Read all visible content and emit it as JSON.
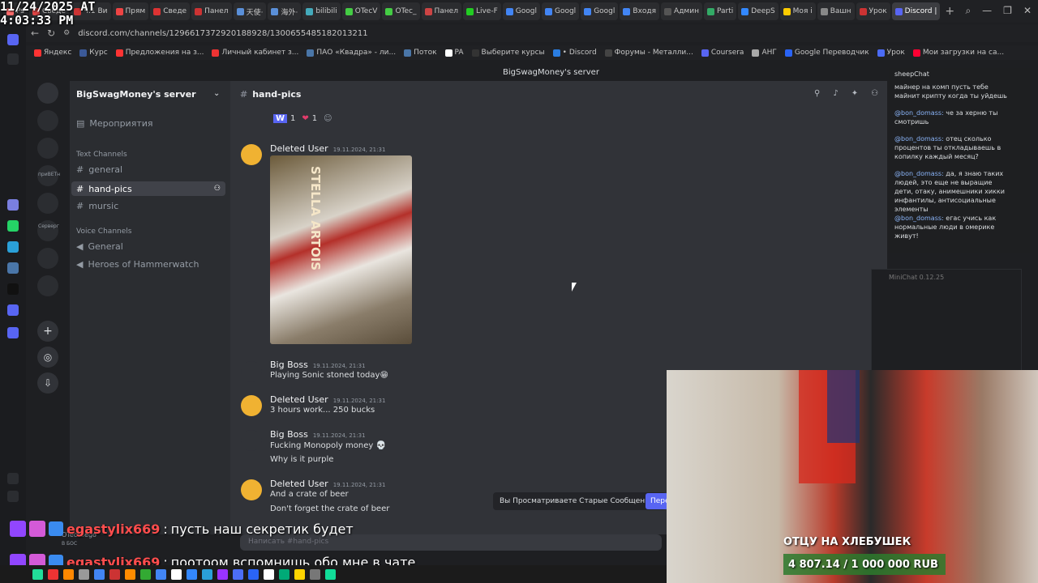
{
  "overlay": {
    "timestamp": "11/24/2025 AT\n4:03:33 PM"
  },
  "browser": {
    "tabs": [
      "Ps",
      "Сведе",
      "Ч.1 Ви",
      "Прям",
      "Сведе",
      "Панел",
      "天使·",
      "海外·",
      "bilibili",
      "OTecV",
      "OTec_",
      "Панел",
      "Live-F",
      "Googl",
      "Googl",
      "Googl",
      "Входя",
      "Админ",
      "Parti",
      "DeepS",
      "Моя і",
      "Вашн",
      "Урок",
      "Discord |"
    ],
    "url": "discord.com/channels/1296617372920188928/1300655485182013211",
    "bookmarks": [
      "Яндекс",
      "Курс",
      "Предложения на з...",
      "Личный кабинет з...",
      "ПАО «Квадра» - ли...",
      "Поток",
      "PA",
      "Выберите курсы",
      "• Discord",
      "Форумы - Металли...",
      "Coursera",
      "АНГ",
      "Google Переводчик",
      "Урок",
      "Мои загрузки на са..."
    ],
    "page_title": "BigSwagMoney's server"
  },
  "server_rail": {
    "label1": "приВЕТн",
    "label2": "Серверг"
  },
  "channels": {
    "server_name": "BigSwagMoney's server",
    "events": "Мероприятия",
    "text_category": "Text Channels",
    "text": [
      "general",
      "hand-pics",
      "mursic"
    ],
    "voice_category": "Voice Channels",
    "voice": [
      "General",
      "Heroes of Hammerwatch"
    ],
    "self_user": "OTecvsego",
    "self_status": "В БОС"
  },
  "chat": {
    "channel_name": "hand-pics",
    "reactions": [
      {
        "emoji": "W",
        "count": "1"
      },
      {
        "emoji": "❤",
        "count": "1"
      }
    ],
    "image_caption": "STELLA ARTOIS",
    "messages": [
      {
        "author": "Deleted User",
        "time": "19.11.2024, 21:31",
        "lines": []
      },
      {
        "author": "Big Boss",
        "time": "19.11.2024, 21:31",
        "lines": [
          "Playing Sonic stoned today😁"
        ]
      },
      {
        "author": "Deleted User",
        "time": "19.11.2024, 21:31",
        "lines": [
          "3 hours work... 250 bucks"
        ]
      },
      {
        "author": "Big Boss",
        "time": "19.11.2024, 21:31",
        "lines": [
          "Fucking Monopoly money 💀",
          "Why is it purple"
        ]
      },
      {
        "author": "Deleted User",
        "time": "19.11.2024, 21:31",
        "lines": [
          "And a crate of beer",
          "Don't forget the crate of beer"
        ]
      }
    ],
    "old_messages_notice": "Вы Просматриваете Старые Сообщения",
    "old_messages_button": "Пере",
    "input_placeholder": "Написать #hand-pics"
  },
  "sheep_chat": {
    "title": "sheepChat",
    "messages": [
      {
        "user": "",
        "text": "майнер на комп пусть тебе майнит крипту когда ты уйдешь"
      },
      {
        "user": "@bon_domass:",
        "text": "че за херню ты смотришь"
      },
      {
        "user": "@bon_domass:",
        "text": "отец сколько процентов ты откладываешь в копилку каждый месяц?"
      },
      {
        "user": "@bon_domass:",
        "text": "да, я знаю таких людей, это еще не выращие дети, отаку, анимешники хикки инфантилы, антисоциальные элементы"
      },
      {
        "user": "@bon_domass:",
        "text": "егас учись как нормальные люди в омерике живут!"
      }
    ]
  },
  "minichat": {
    "title": "MiniChat 0.12.25"
  },
  "stream": {
    "caption": "ОТЦУ НА ХЛЕБУШЕК",
    "goal": "4 807.14 / 1 000 000 RUB"
  },
  "twitch_chat": [
    {
      "user": "egastylix669",
      "text": "пусть наш секретик будет"
    },
    {
      "user": "egastylix669",
      "text": "поотоом вспомнишь обо мне в чате"
    }
  ],
  "colors": {
    "blurple": "#5865f2",
    "bg": "#313338",
    "sidebar": "#2b2d31",
    "rail": "#1e1f22"
  }
}
